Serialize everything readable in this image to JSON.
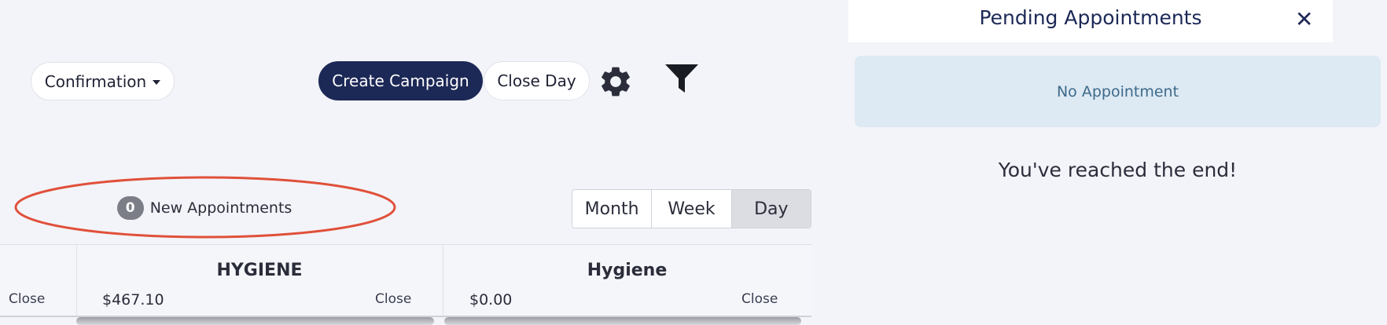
{
  "toolbar": {
    "confirmation_label": "Confirmation",
    "create_campaign_label": "Create Campaign",
    "close_day_label": "Close Day",
    "settings_icon": "gear-icon",
    "filter_icon": "funnel-icon"
  },
  "new_appointments": {
    "count": "0",
    "label": "New Appointments"
  },
  "views": {
    "month": "Month",
    "week": "Week",
    "day": "Day",
    "active": "Day"
  },
  "columns": [
    {
      "title": "",
      "amount": "",
      "close_label": "Close"
    },
    {
      "title": "HYGIENE",
      "amount": "$467.10",
      "close_label": "Close"
    },
    {
      "title": "Hygiene",
      "amount": "$0.00",
      "close_label": "Close"
    }
  ],
  "panel": {
    "title": "Pending Appointments",
    "empty_message": "No Appointment",
    "end_message": "You've reached the end!"
  },
  "colors": {
    "primary": "#1c2856",
    "background": "#f3f4f9",
    "info_bg": "#dde9f3",
    "annotation": "#e0503a"
  }
}
